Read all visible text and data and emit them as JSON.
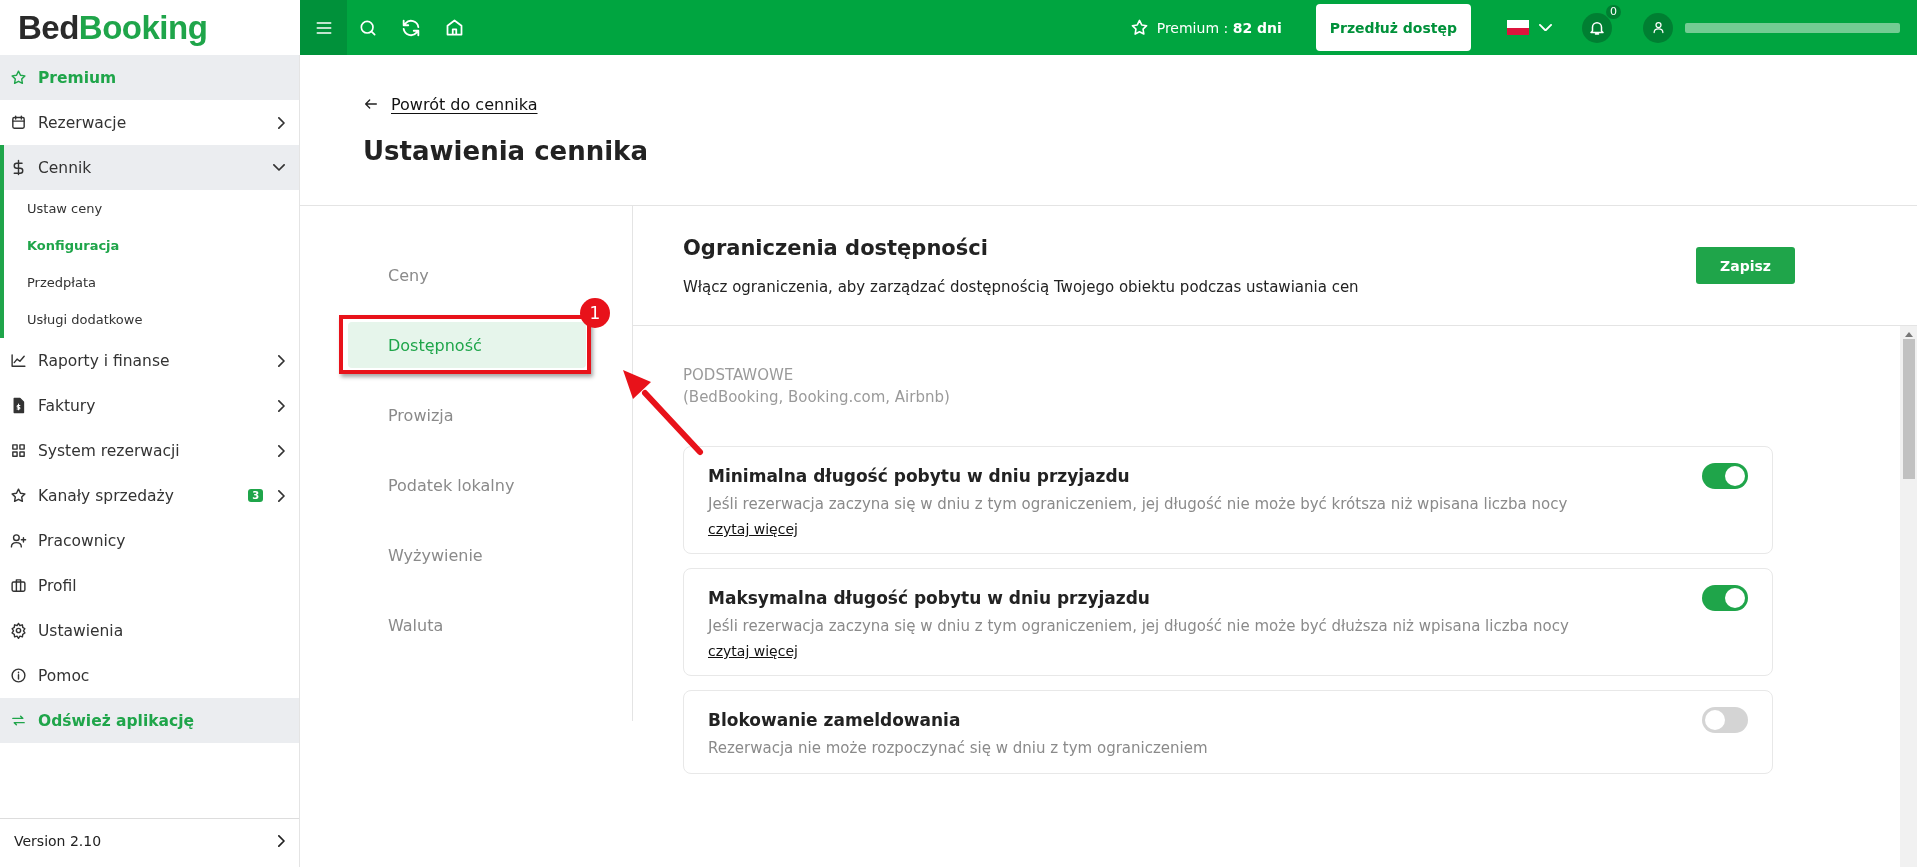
{
  "logo": [
    "Bed",
    "Booking"
  ],
  "topbar": {
    "premium": "Premium : **82 dni**",
    "extend_button": "Przedłuż dostęp",
    "notifications_badge": "0"
  },
  "sidebar": {
    "items": [
      {
        "kind": "highlight",
        "label": "Premium"
      },
      {
        "kind": "group",
        "label": "Rezerwacje",
        "expanded": false
      },
      {
        "kind": "group",
        "label": "Cennik",
        "expanded": true,
        "children": [
          {
            "label": "Ustaw ceny",
            "selected": false
          },
          {
            "label": "Konfiguracja",
            "selected": true
          },
          {
            "label": "Przedpłata",
            "selected": false
          },
          {
            "label": "Usługi dodatkowe",
            "selected": false
          }
        ]
      },
      {
        "kind": "group",
        "label": "Raporty i finanse",
        "expanded": false
      },
      {
        "kind": "group",
        "label": "Faktury",
        "expanded": false
      },
      {
        "kind": "group",
        "label": "System rezerwacji",
        "expanded": false
      },
      {
        "kind": "group",
        "label": "Kanały sprzedaży",
        "expanded": false,
        "badge": "3"
      },
      {
        "kind": "link",
        "label": "Pracownicy"
      },
      {
        "kind": "link",
        "label": "Profil"
      },
      {
        "kind": "link",
        "label": "Ustawienia"
      },
      {
        "kind": "link",
        "label": "Pomoc"
      },
      {
        "kind": "highlight",
        "label": "Odśwież aplikację"
      }
    ],
    "version": "Version 2.10"
  },
  "page": {
    "back_link": "Powrót do cennika",
    "title": "Ustawienia cennika"
  },
  "tabs": [
    {
      "label": "Ceny",
      "selected": false
    },
    {
      "label": "Dostępność",
      "selected": true,
      "annotation": "1"
    },
    {
      "label": "Prowizja",
      "selected": false
    },
    {
      "label": "Podatek lokalny",
      "selected": false
    },
    {
      "label": "Wyżywienie",
      "selected": false
    },
    {
      "label": "Waluta",
      "selected": false
    }
  ],
  "section": {
    "title": "Ograniczenia dostępności",
    "subtitle": "Włącz ograniczenia, aby zarządzać dostępnością Twojego obiektu podczas ustawiania cen",
    "save_button": "Zapisz",
    "group_label": "PODSTAWOWE",
    "group_note": "(BedBooking, Booking.com, Airbnb)",
    "cards": [
      {
        "title": "Minimalna długość pobytu w dniu przyjazdu",
        "description": "Jeśli rezerwacja zaczyna się w dniu z tym ograniczeniem, jej długość nie może być krótsza niż wpisana liczba nocy",
        "link": "czytaj więcej",
        "on": true
      },
      {
        "title": "Maksymalna długość pobytu w dniu przyjazdu",
        "description": "Jeśli rezerwacja zaczyna się w dniu z tym ograniczeniem, jej długość nie może być dłuższa niż wpisana liczba nocy",
        "link": "czytaj więcej",
        "on": true
      },
      {
        "title": "Blokowanie zameldowania",
        "description": "Rezerwacja nie może rozpoczynać się w dniu z tym ograniczeniem",
        "on": false
      }
    ]
  }
}
